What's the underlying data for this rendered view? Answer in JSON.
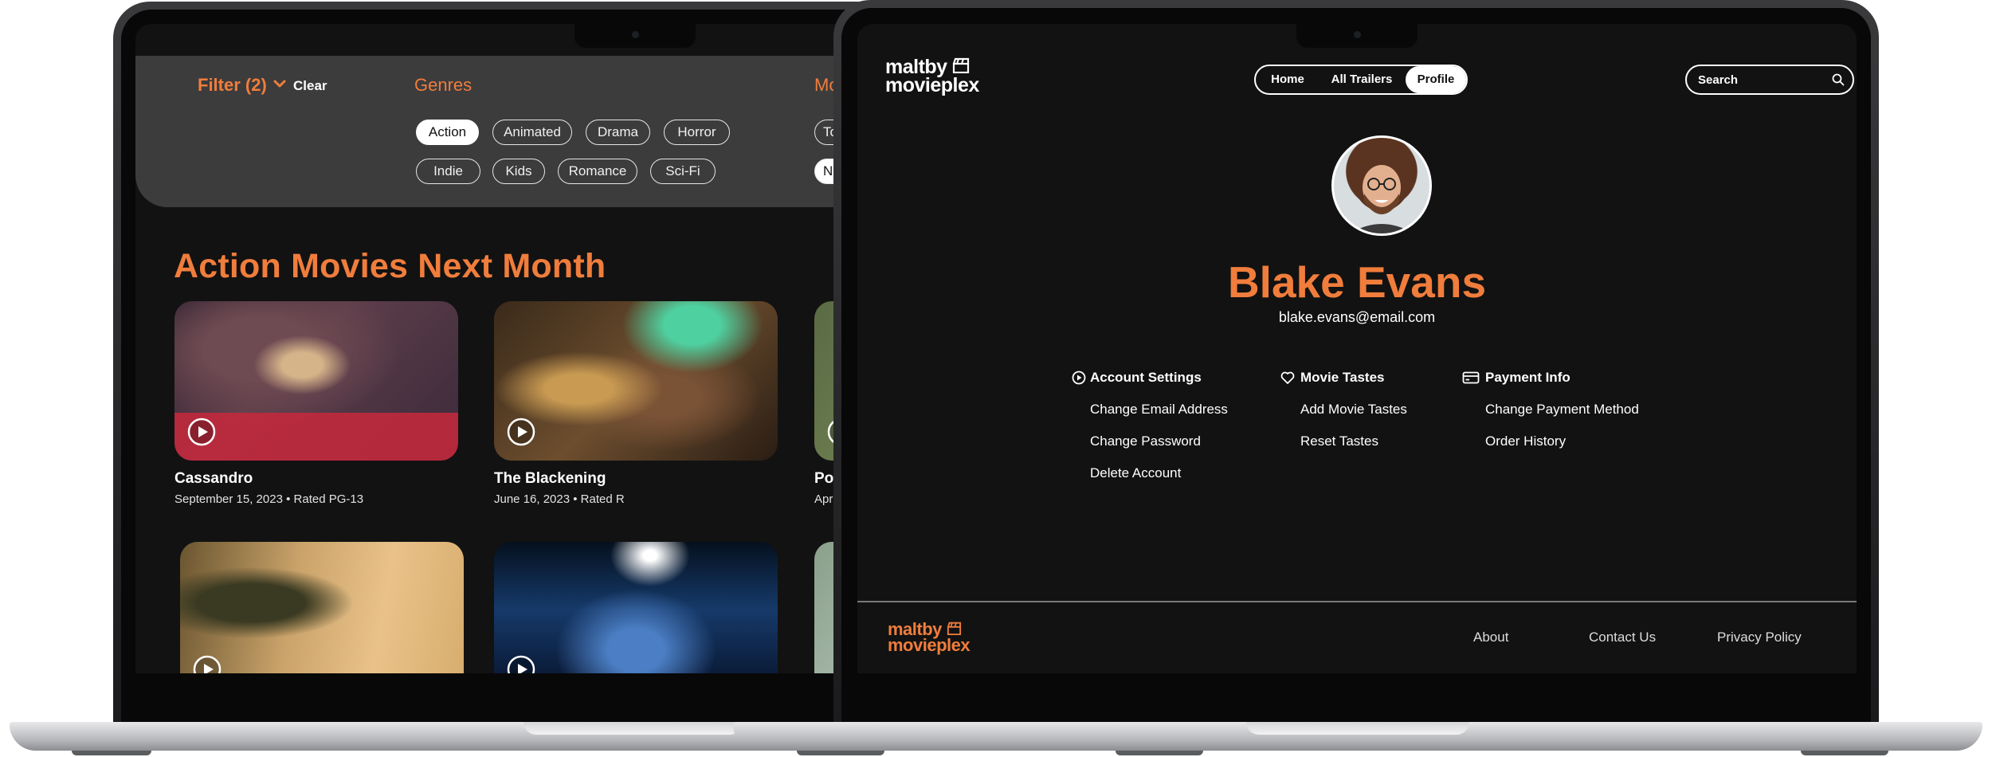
{
  "left_screen": {
    "filter": {
      "label": "Filter (2)",
      "clear_label": "Clear"
    },
    "genres": {
      "label": "Genres",
      "chips": [
        "Action",
        "Animated",
        "Drama",
        "Horror",
        "Indie",
        "Kids",
        "Romance",
        "Sci-Fi"
      ],
      "active": "Action"
    },
    "cut_section": {
      "label": "Mo",
      "chips": [
        "To",
        "N"
      ]
    },
    "section_title": "Action Movies Next Month",
    "movies": [
      {
        "title": "Cassandro",
        "meta": "September 15, 2023 • Rated PG-13"
      },
      {
        "title": "The Blackening",
        "meta": "June 16, 2023 • Rated R"
      },
      {
        "title": "Po",
        "meta": "Apr"
      }
    ]
  },
  "right_screen": {
    "logo": {
      "line1": "maltby",
      "line2": "movieplex"
    },
    "nav": {
      "items": [
        "Home",
        "All Trailers",
        "Profile"
      ],
      "active": "Profile"
    },
    "search": {
      "placeholder": "Search"
    },
    "profile": {
      "name": "Blake Evans",
      "email": "blake.evans@email.com"
    },
    "settings_columns": [
      {
        "heading": "Account Settings",
        "icon": "play-circle-icon",
        "links": [
          "Change Email Address",
          "Change Password",
          "Delete Account"
        ]
      },
      {
        "heading": "Movie Tastes",
        "icon": "heart-icon",
        "links": [
          "Add Movie Tastes",
          "Reset Tastes"
        ]
      },
      {
        "heading": "Payment Info",
        "icon": "credit-card-icon",
        "links": [
          "Change Payment Method",
          "Order History"
        ]
      }
    ],
    "footer": {
      "links": [
        "About",
        "Contact Us",
        "Privacy Policy"
      ]
    }
  },
  "colors": {
    "accent": "#f07d3c",
    "background": "#121212",
    "panel": "#3c3c3c",
    "text": "#ffffff"
  }
}
